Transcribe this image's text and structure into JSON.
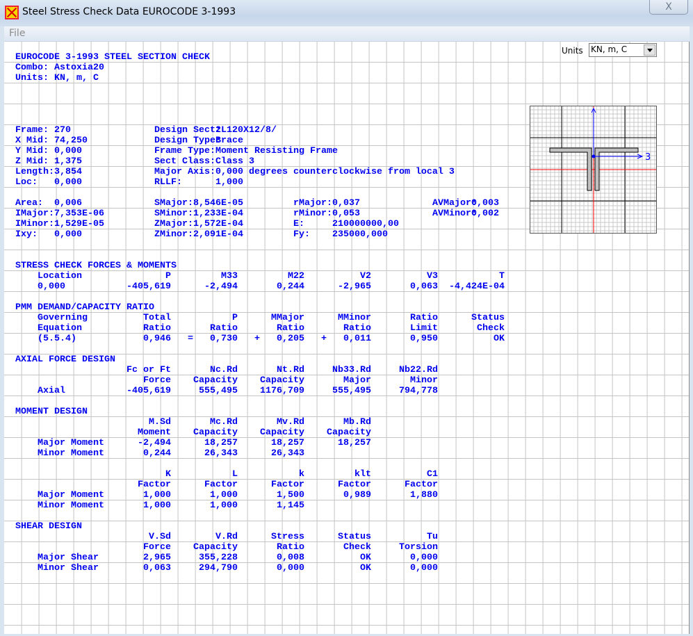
{
  "window": {
    "title": "Steel Stress Check Data  EUROCODE 3-1993",
    "close": "X"
  },
  "menu": {
    "file": "File"
  },
  "units": {
    "label": "Units",
    "value": "KN, m, C"
  },
  "header": {
    "title": "EUROCODE 3-1993 STEEL SECTION CHECK",
    "combo_label": "Combo",
    "combo": "Astoxia20",
    "units_label": "Units",
    "units": "KN, m, C"
  },
  "frame_info": [
    [
      {
        "k": "Frame",
        "v": "270"
      },
      {
        "k": "Design Sect",
        "v": "2L120X12/8/"
      }
    ],
    [
      {
        "k": "X Mid",
        "v": "74,250"
      },
      {
        "k": "Design Type",
        "v": "Brace"
      }
    ],
    [
      {
        "k": "Y Mid",
        "v": "0,000"
      },
      {
        "k": "Frame Type",
        "v": "Moment Resisting Frame"
      }
    ],
    [
      {
        "k": "Z Mid",
        "v": "1,375"
      },
      {
        "k": "Sect Class",
        "v": "Class 3"
      }
    ],
    [
      {
        "k": "Length",
        "v": "3,854"
      },
      {
        "k": "Major Axis",
        "v": "0,000 degrees counterclockwise from local 3"
      }
    ],
    [
      {
        "k": "Loc",
        "v": "0,000"
      },
      {
        "k": "RLLF",
        "v": "1,000"
      }
    ]
  ],
  "section_props": [
    [
      {
        "k": "Area",
        "v": "0,006"
      },
      {
        "k": "SMajor",
        "v": "8,546E-05"
      },
      {
        "k": "rMajor",
        "v": "0,037"
      },
      {
        "k": "AVMajor",
        "v": "0,003"
      }
    ],
    [
      {
        "k": "IMajor",
        "v": "7,353E-06"
      },
      {
        "k": "SMinor",
        "v": "1,233E-04"
      },
      {
        "k": "rMinor",
        "v": "0,053"
      },
      {
        "k": "AVMinor",
        "v": "0,002"
      }
    ],
    [
      {
        "k": "IMinor",
        "v": "1,529E-05"
      },
      {
        "k": "ZMajor",
        "v": "1,572E-04"
      },
      {
        "k": "E",
        "v": "210000000,00"
      }
    ],
    [
      {
        "k": "Ixy",
        "v": "0,000"
      },
      {
        "k": "ZMinor",
        "v": "2,091E-04"
      },
      {
        "k": "Fy",
        "v": "235000,000"
      }
    ]
  ],
  "tables": [
    {
      "title": "STRESS CHECK FORCES & MOMENTS",
      "rows": [
        [
          "Location",
          "P",
          "M33",
          "M22",
          "V2",
          "V3",
          "T"
        ],
        [
          "0,000",
          "-405,619",
          "-2,494",
          "0,244",
          "-2,965",
          "0,063",
          "-4,424E-04"
        ]
      ]
    },
    {
      "title": "PMM DEMAND/CAPACITY RATIO",
      "rows": [
        [
          "Governing",
          "Total",
          "P",
          "MMajor",
          "MMinor",
          "Ratio",
          "Status"
        ],
        [
          "Equation",
          "Ratio",
          "Ratio",
          "Ratio",
          "Ratio",
          "Limit",
          "Check"
        ],
        [
          "(5.5.4)",
          "0,946",
          "=   0,730",
          "+   0,205",
          "+   0,011",
          "0,950",
          "OK"
        ]
      ]
    },
    {
      "title": "AXIAL FORCE DESIGN",
      "rows": [
        [
          "",
          "Fc or Ft",
          "Nc.Rd",
          "Nt.Rd",
          "Nb33.Rd",
          "Nb22.Rd"
        ],
        [
          "",
          "Force",
          "Capacity",
          "Capacity",
          "Major",
          "Minor"
        ],
        [
          "Axial",
          "-405,619",
          "555,495",
          "1176,709",
          "555,495",
          "794,778"
        ]
      ]
    },
    {
      "title": "MOMENT DESIGN",
      "rows": [
        [
          "",
          "M.Sd",
          "Mc.Rd",
          "Mv.Rd",
          "Mb.Rd"
        ],
        [
          "",
          "Moment",
          "Capacity",
          "Capacity",
          "Capacity"
        ],
        [
          "Major Moment",
          "-2,494",
          "18,257",
          "18,257",
          "18,257"
        ],
        [
          "Minor Moment",
          "0,244",
          "26,343",
          "26,343"
        ],
        null,
        [
          "",
          "K",
          "L",
          "k",
          "klt",
          "C1"
        ],
        [
          "",
          "Factor",
          "Factor",
          "Factor",
          "Factor",
          "Factor"
        ],
        [
          "Major Moment",
          "1,000",
          "1,000",
          "1,500",
          "0,989",
          "1,880"
        ],
        [
          "Minor Moment",
          "1,000",
          "1,000",
          "1,145"
        ]
      ]
    },
    {
      "title": "SHEAR DESIGN",
      "rows": [
        [
          "",
          "V.Sd",
          "V.Rd",
          "Stress",
          "Status",
          "Tu"
        ],
        [
          "",
          "Force",
          "Capacity",
          "Ratio",
          "Check",
          "Torsion"
        ],
        [
          "Major Shear",
          "2,965",
          "355,228",
          "0,008",
          "OK",
          "0,000"
        ],
        [
          "Minor Shear",
          "0,063",
          "294,790",
          "0,000",
          "OK",
          "0,000"
        ]
      ]
    }
  ],
  "colors": {
    "text": "#0000f0",
    "axis": "#0000ff",
    "centroid_lines": "#ff0000",
    "section_fill": "#c0c0c0"
  },
  "section_diagram": {
    "axis_label": "3"
  }
}
